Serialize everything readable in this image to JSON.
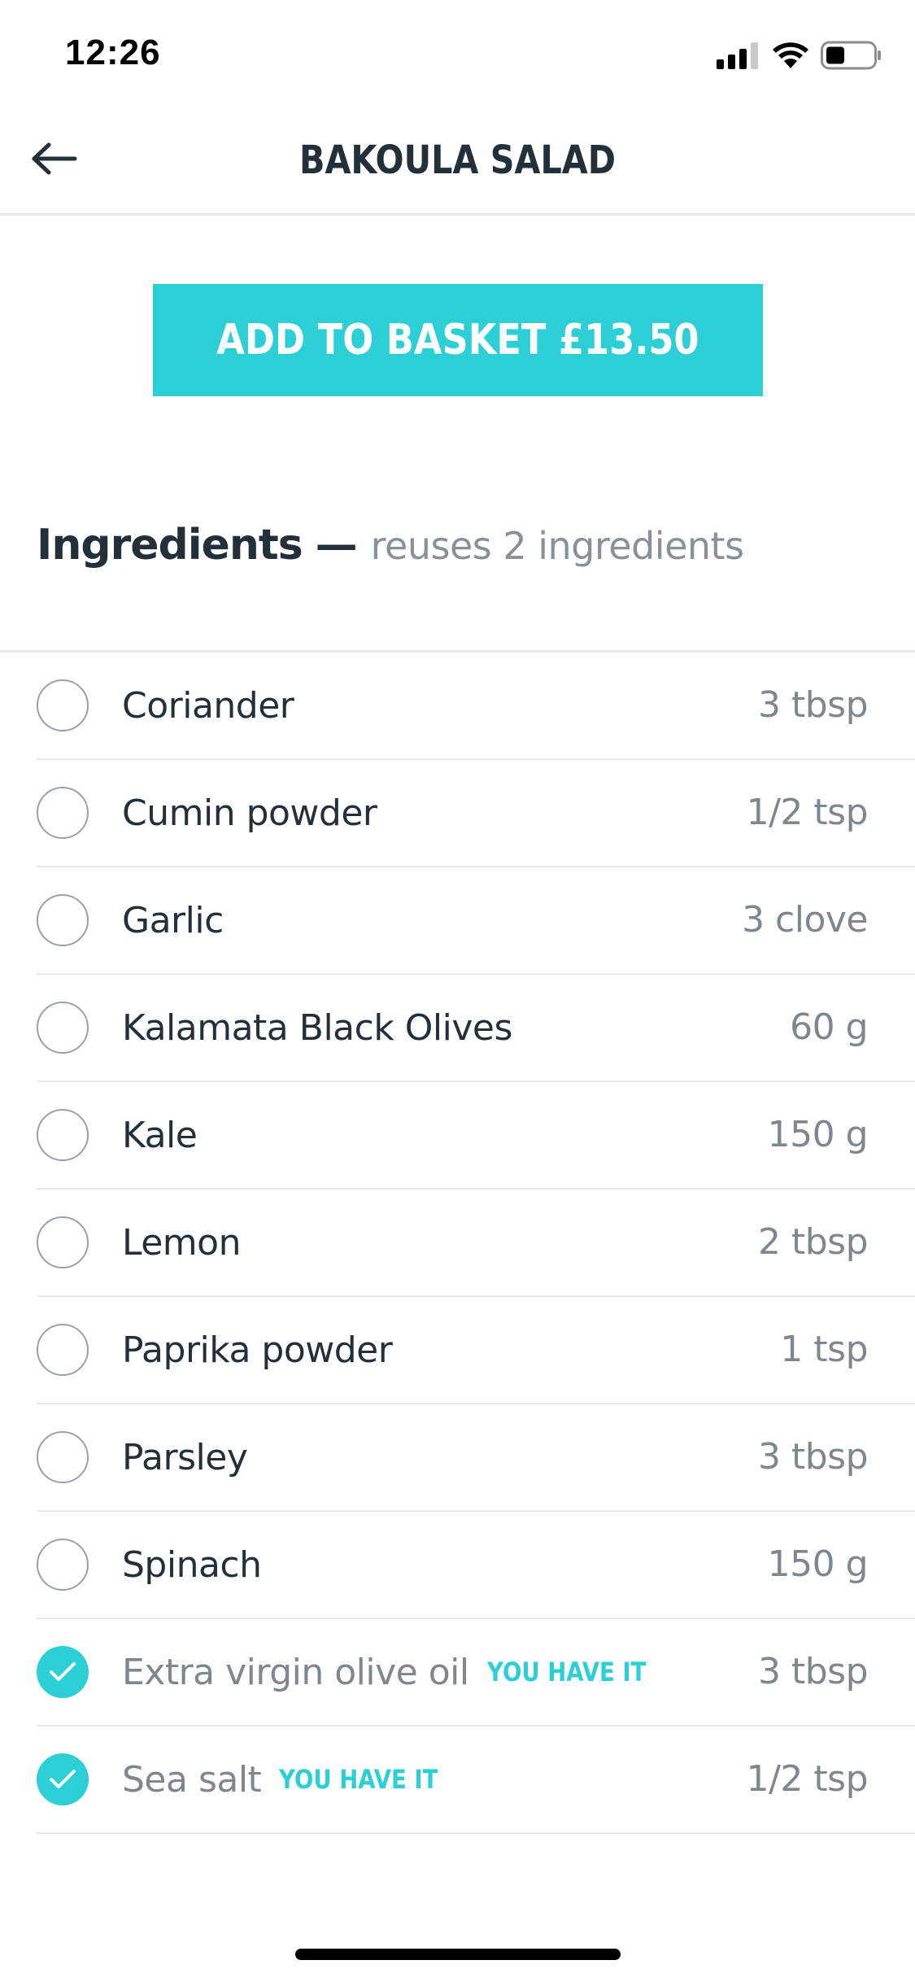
{
  "status_bar": {
    "time": "12:26",
    "icons": [
      "cellular-signal-icon",
      "wifi-icon",
      "battery-icon"
    ]
  },
  "header": {
    "back_icon": "arrow-left-icon",
    "title": "BAKOULA SALAD"
  },
  "basket": {
    "label": "ADD TO BASKET £13.50",
    "color": "#2ccfd6"
  },
  "ingredients": {
    "title": "Ingredients",
    "separator": "—",
    "subtitle": "reuses 2 ingredients",
    "have_label": "YOU HAVE IT",
    "items": [
      {
        "name": "Coriander",
        "qty": "3 tbsp",
        "owned": false
      },
      {
        "name": "Cumin powder",
        "qty": "1/2 tsp",
        "owned": false
      },
      {
        "name": "Garlic",
        "qty": "3 clove",
        "owned": false
      },
      {
        "name": "Kalamata Black Olives",
        "qty": "60 g",
        "owned": false
      },
      {
        "name": "Kale",
        "qty": "150 g",
        "owned": false
      },
      {
        "name": "Lemon",
        "qty": "2 tbsp",
        "owned": false
      },
      {
        "name": "Paprika powder",
        "qty": "1 tsp",
        "owned": false
      },
      {
        "name": "Parsley",
        "qty": "3 tbsp",
        "owned": false
      },
      {
        "name": "Spinach",
        "qty": "150 g",
        "owned": false
      },
      {
        "name": "Extra virgin olive oil",
        "qty": "3 tbsp",
        "owned": true
      },
      {
        "name": "Sea salt",
        "qty": "1/2 tsp",
        "owned": true
      }
    ]
  },
  "colors": {
    "accent": "#2ccfd6",
    "text_dark": "#233039",
    "text_muted": "#7f878c",
    "divider": "#e6e8ea"
  }
}
